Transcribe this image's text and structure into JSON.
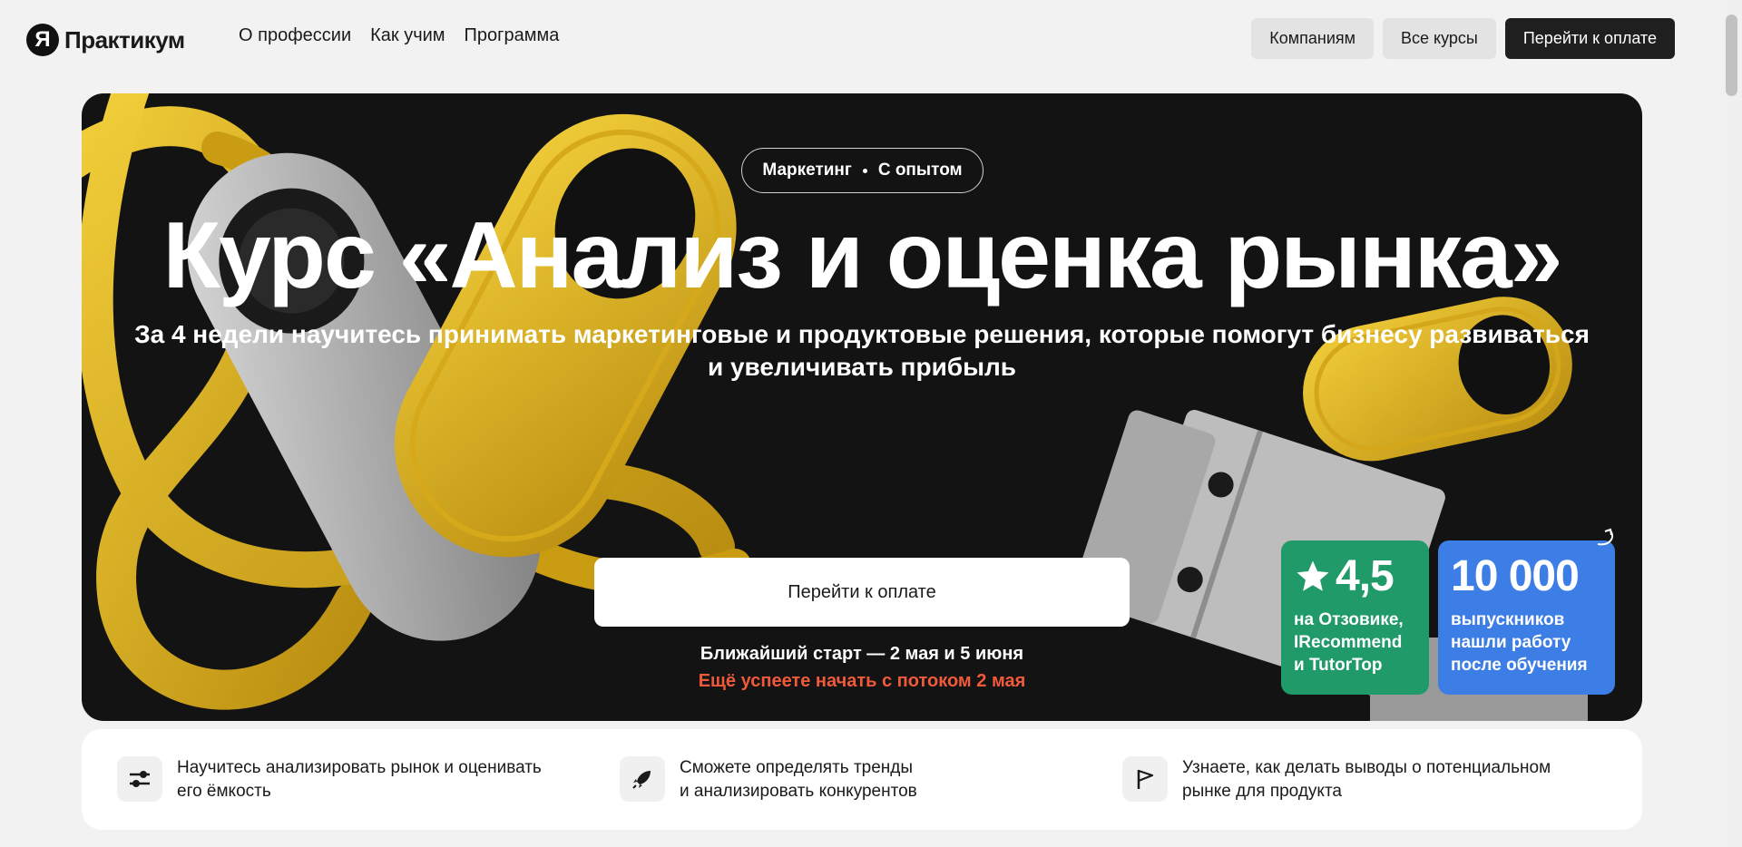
{
  "header": {
    "logo_mark": "Я",
    "logo_text": "Практикум",
    "nav": [
      "О профессии",
      "Как учим",
      "Программа"
    ],
    "buttons": {
      "companies": "Компаниям",
      "all_courses": "Все курсы",
      "pay": "Перейти к оплате"
    }
  },
  "hero": {
    "tag_left": "Маркетинг",
    "tag_right": "С опытом",
    "title": "Курс «Анализ и оценка рынка»",
    "subtitle_line1": "За 4 недели научитесь принимать маркетинговые и продуктовые решения, которые помогут бизнесу развиваться",
    "subtitle_line2": "и увеличивать прибыль",
    "cta": "Перейти к оплате",
    "start": "Ближайший старт — 2 мая и 5 июня",
    "hurry": "Ещё успеете начать с потоком 2 мая"
  },
  "stats": {
    "rating": {
      "value": "4,5",
      "line1": "на Отзовике,",
      "line2": "IRecommend",
      "line3": "и TutorTop",
      "color": "#1f9a68"
    },
    "graduates": {
      "value": "10 000",
      "line1": "выпускников",
      "line2": "нашли работу",
      "line3": "после обучения",
      "color": "#3d7de6"
    }
  },
  "features": [
    {
      "icon": "sliders-icon",
      "line1": "Научитесь анализировать рынок и оценивать",
      "line2": "его ёмкость"
    },
    {
      "icon": "rocket-icon",
      "line1": "Сможете определять тренды",
      "line2": "и анализировать конкурентов"
    },
    {
      "icon": "flag-icon",
      "line1": "Узнаете, как делать выводы о потенциальном",
      "line2": "рынке для продукта"
    }
  ],
  "colors": {
    "accent_red": "#f05a3a",
    "hero_bg": "#131313",
    "yellow": "#e0b520"
  }
}
